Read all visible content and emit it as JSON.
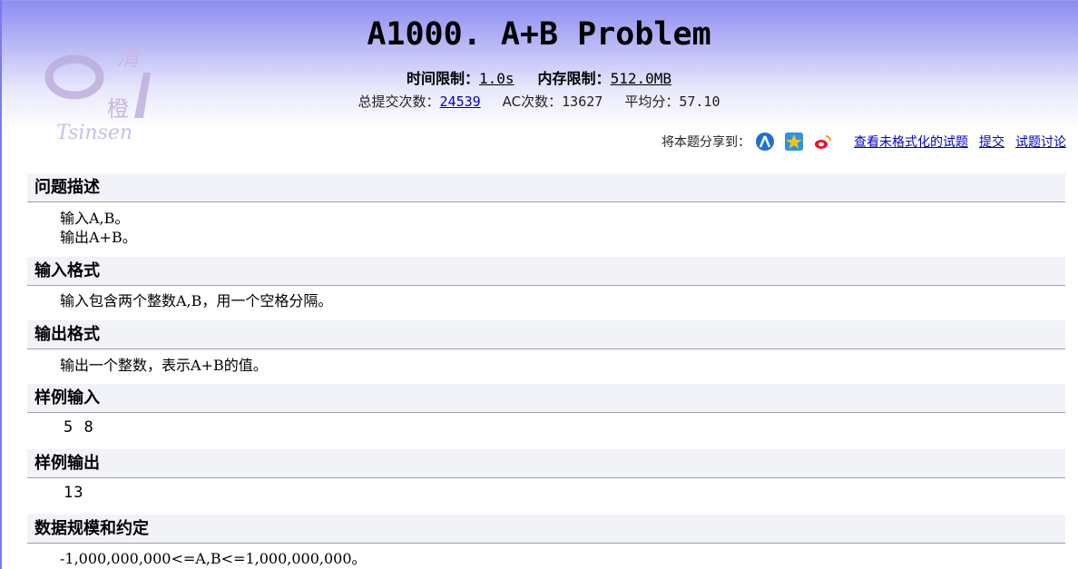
{
  "problem": {
    "title": "A1000.  A+B Problem",
    "time_limit_label": "时间限制：",
    "time_limit": "1.0s",
    "memory_limit_label": "内存限制：",
    "memory_limit": "512.0MB",
    "submissions_label": "总提交次数：",
    "submissions": "24539",
    "ac_label": "AC次数：",
    "ac_count": "13627",
    "avg_label": "平均分：",
    "avg_score": "57.10"
  },
  "logo": {
    "char1": "清",
    "char2": "橙",
    "text": "Tsinsen"
  },
  "share": {
    "label": "将本题分享到：",
    "icons": [
      "renren-icon",
      "qzone-icon",
      "weibo-icon"
    ],
    "links": [
      "查看未格式化的试题",
      "提交",
      "试题讨论"
    ]
  },
  "sections": {
    "description": {
      "title": "问题描述",
      "lines": [
        "输入A,B。",
        "输出A+B。"
      ]
    },
    "input_format": {
      "title": "输入格式",
      "lines": [
        "输入包含两个整数A,B，用一个空格分隔。"
      ]
    },
    "output_format": {
      "title": "输出格式",
      "lines": [
        "输出一个整数，表示A+B的值。"
      ]
    },
    "sample_input": {
      "title": "样例输入",
      "lines": [
        "5 8"
      ]
    },
    "sample_output": {
      "title": "样例输出",
      "lines": [
        "13"
      ]
    },
    "constraints": {
      "title": "数据规模和约定",
      "lines": [
        "-1,000,000,000<=A,B<=1,000,000,000。"
      ]
    }
  },
  "colors": {
    "link": "#0000cc",
    "header_top": "#8c8cf0",
    "section_bg": "#f1f3f8"
  }
}
